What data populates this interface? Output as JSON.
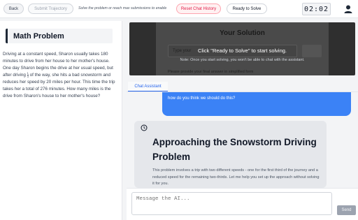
{
  "toolbar": {
    "back_label": "Back",
    "submit_label": "Submit Trajectory",
    "hint_text": "Solve the problem or reach max submissions to enable",
    "reset_label": "Reset Chat History",
    "ready_label": "Ready to Solve",
    "timer": "02:02"
  },
  "problem": {
    "title": "Math Problem",
    "text_before": "Driving at a constant speed, Sharon usually takes 180 minutes to drive from her house to her mother's house. One day Sharon begins the drive at her usual speed, but after driving ",
    "frac_num": "1",
    "frac_den": "3",
    "text_after": " of the way, she hits a bad snowstorm and reduces her speed by 20 miles per hour. This time the trip takes her a total of 276 minutes. How many miles is the drive from Sharon's house to her mother's house?"
  },
  "solution": {
    "title": "Your Solution",
    "input_placeholder": "Type your",
    "footer": "Please provide your final answer in simplified form",
    "overlay_main": "Click \"Ready to Solve\" to start solving.",
    "overlay_note": "Note: Once you start solving, you won't be able to chat with the assistant."
  },
  "chat": {
    "tab_label": "Chat Assistant",
    "user_message": "how do you think we should do this?",
    "ai_heading": "Approaching the Snowstorm Driving Problem",
    "ai_body": "This problem involves a trip with two different speeds - one for the first third of the journey and a reduced speed for the remaining two-thirds. Let me help you set up the approach without solving it for you.",
    "input_placeholder": "Message the AI...",
    "send_label": "Send"
  },
  "colors": {
    "accent": "#3b82f6",
    "reset": "#e11d48"
  },
  "icons": {
    "user": "user-icon",
    "clock": "clock-icon"
  }
}
